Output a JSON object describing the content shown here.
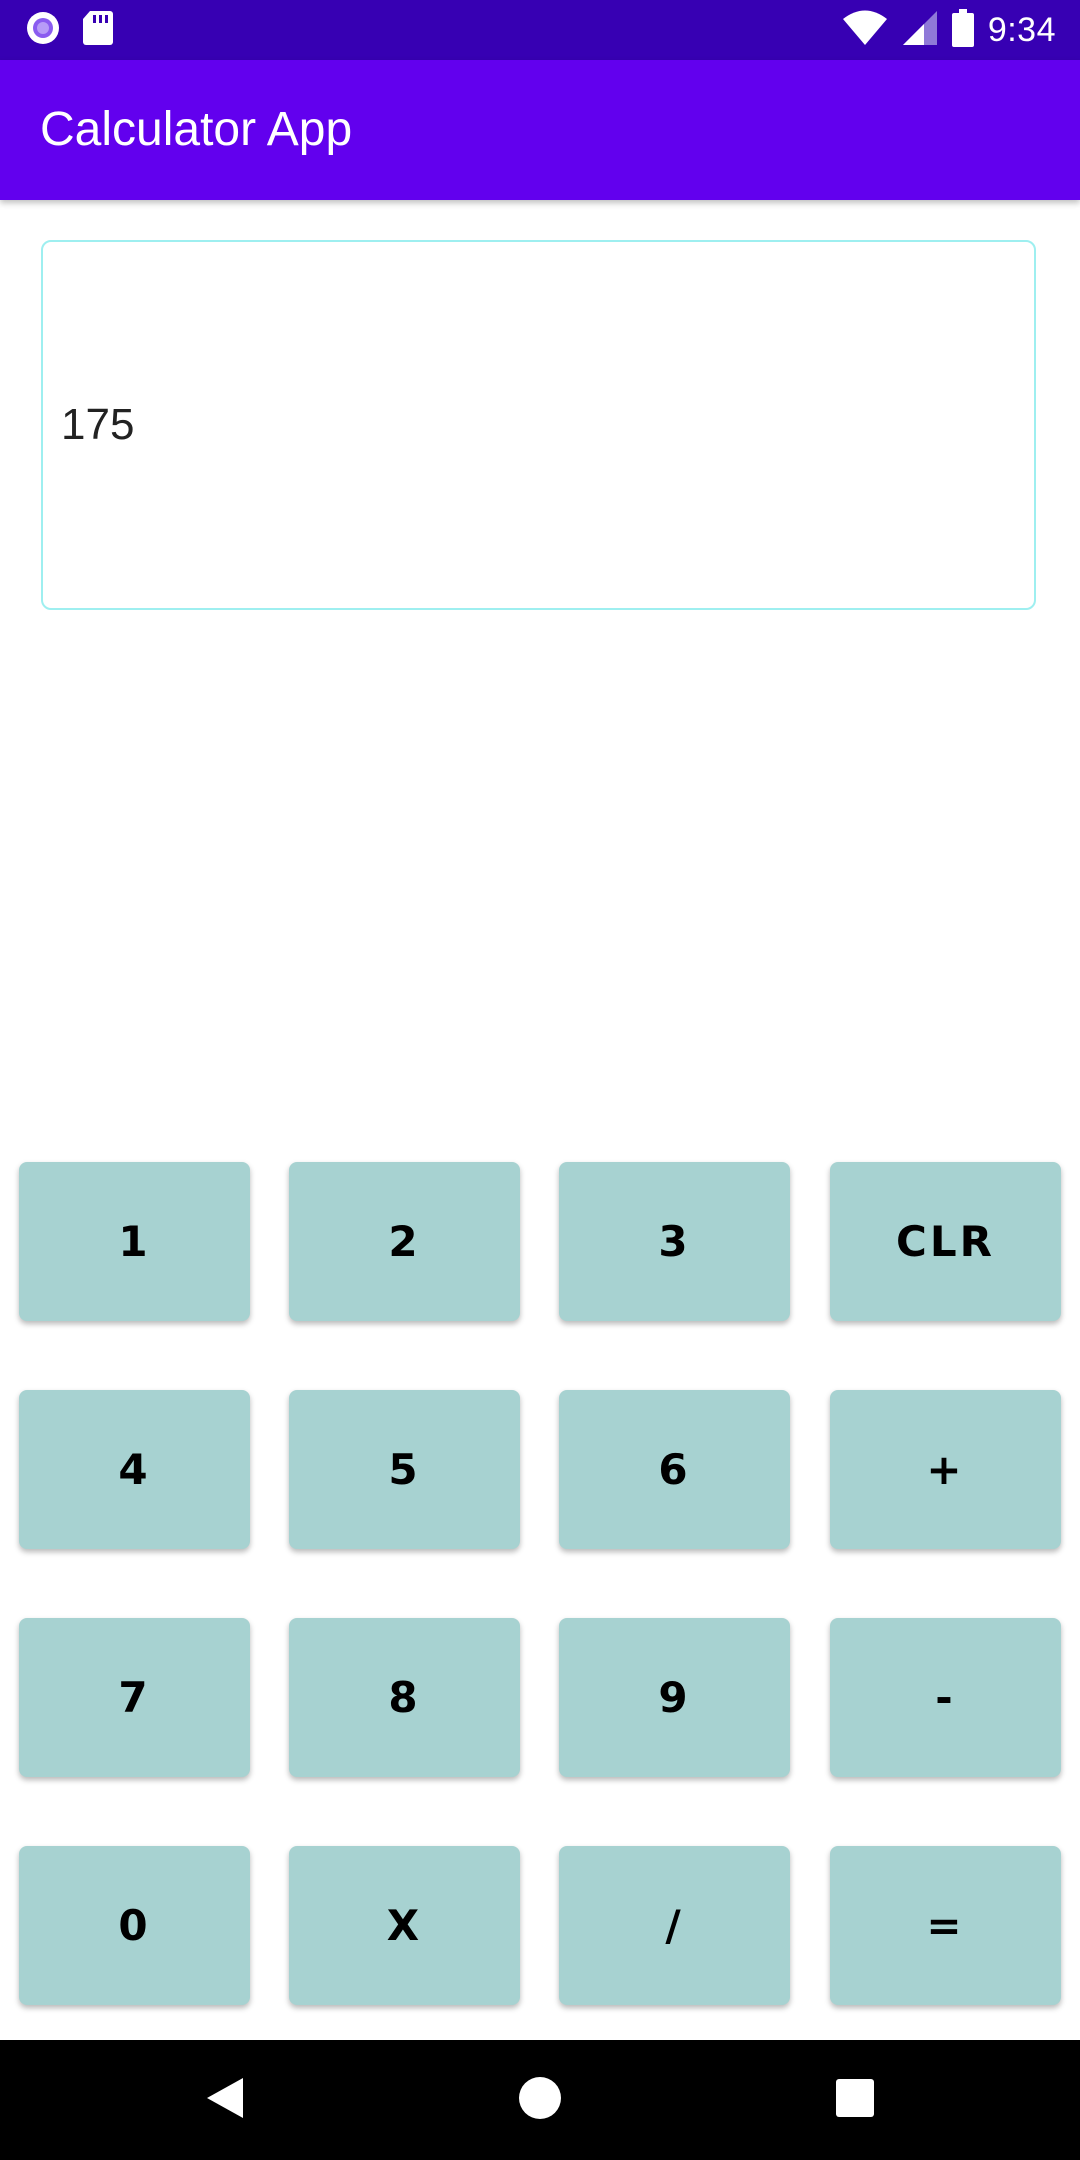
{
  "status_bar": {
    "time": "9:34",
    "left_icons": [
      "record-icon",
      "sd-card-icon"
    ],
    "right_icons": [
      "wifi-icon",
      "cell-signal-icon",
      "battery-icon"
    ],
    "background": "#3700b3"
  },
  "app_bar": {
    "title": "Calculator App",
    "background": "#6200ee"
  },
  "display": {
    "value": "175",
    "border_color": "#9eeff0"
  },
  "keypad": {
    "key_color": "#a7d2d1",
    "keys": [
      "1",
      "2",
      "3",
      "CLR",
      "4",
      "5",
      "6",
      "+",
      "7",
      "8",
      "9",
      "-",
      "0",
      "X",
      "/",
      "="
    ]
  },
  "nav_bar": {
    "buttons": [
      "back-icon",
      "home-icon",
      "recents-icon"
    ]
  }
}
